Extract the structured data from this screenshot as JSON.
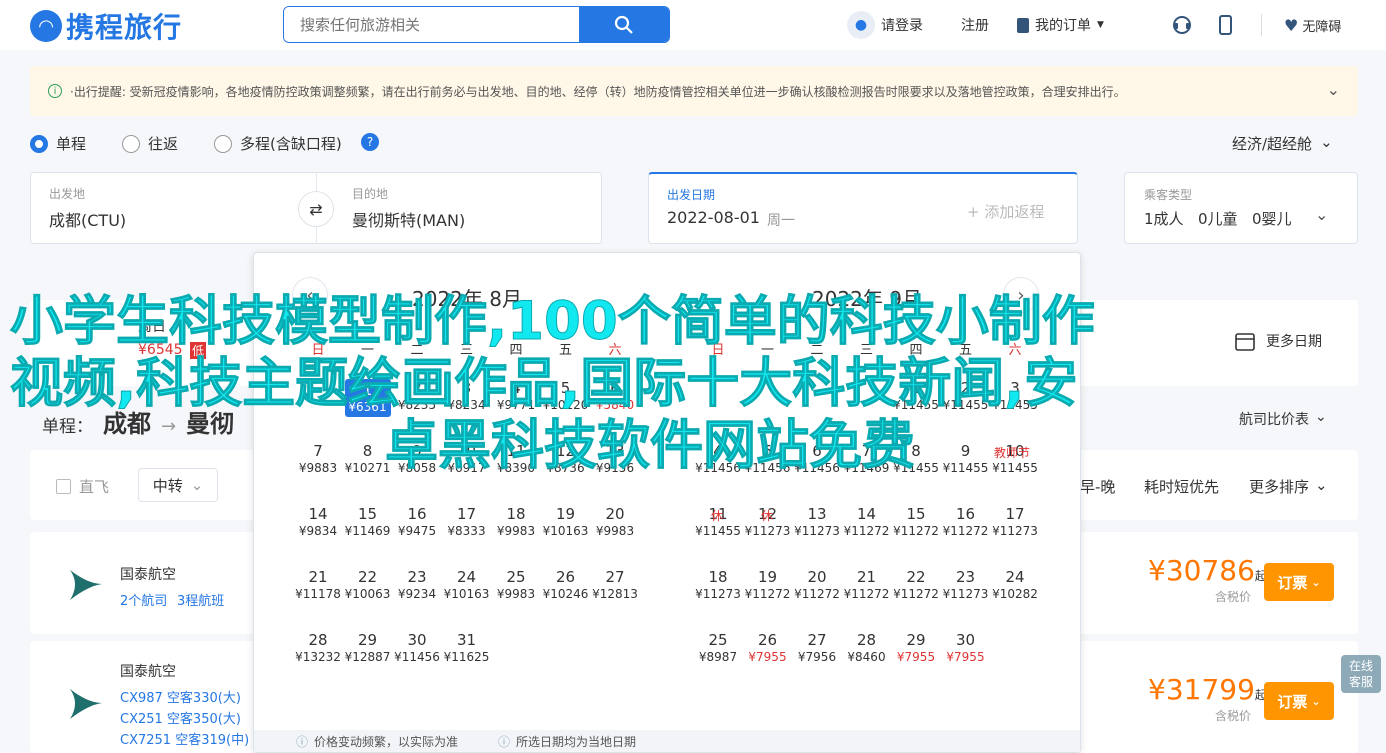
{
  "header": {
    "logo": "携程旅行",
    "search_placeholder": "搜索任何旅游相关",
    "login": "请登录",
    "register": "注册",
    "my_orders": "我的订单",
    "accessible": "无障碍"
  },
  "notice": {
    "text": "·出行提醒: 受新冠疫情影响，各地疫情防控政策调整频繁，请在出行前务必与出发地、目的地、经停（转）地防疫情管控相关单位进一步确认核酸检测报告时限要求以及落地管控政策，合理安排出行。"
  },
  "trip_types": {
    "one_way": "单程",
    "round_trip": "往返",
    "multi": "多程(含缺口程)",
    "cabin_class": "经济/超经舱"
  },
  "search_form": {
    "from_label": "出发地",
    "from_value": "成都(CTU)",
    "to_label": "目的地",
    "to_value": "曼彻斯特(MAN)",
    "date_label": "出发日期",
    "date_value": "2022-08-01",
    "date_weekday": "周一",
    "add_return": "+ 添加返程",
    "passenger_label": "乘客类型",
    "adult": "1成人",
    "child": "0儿童",
    "infant": "0婴儿"
  },
  "calendar": {
    "left_title": "2022年 8月",
    "right_title": "2022年 9月",
    "weekdays": [
      "日",
      "一",
      "二",
      "三",
      "四",
      "五",
      "六"
    ],
    "august": [
      {
        "d": "1",
        "p": "¥6361",
        "sel": true
      },
      {
        "d": "2",
        "p": "¥8235"
      },
      {
        "d": "3",
        "p": "¥8234"
      },
      {
        "d": "4",
        "p": "¥9771"
      },
      {
        "d": "5",
        "p": "¥10120"
      },
      {
        "d": "6",
        "p": "¥5840",
        "red": true
      },
      {
        "d": "7",
        "p": "¥9883"
      },
      {
        "d": "8",
        "p": "¥10271"
      },
      {
        "d": "9",
        "p": "¥8058"
      },
      {
        "d": "10",
        "p": "¥6917"
      },
      {
        "d": "11",
        "p": "¥8390"
      },
      {
        "d": "12",
        "p": "¥8736"
      },
      {
        "d": "13",
        "p": "¥9156"
      },
      {
        "d": "14",
        "p": "¥9834"
      },
      {
        "d": "15",
        "p": "¥11469"
      },
      {
        "d": "16",
        "p": "¥9475"
      },
      {
        "d": "17",
        "p": "¥8333"
      },
      {
        "d": "18",
        "p": "¥9983"
      },
      {
        "d": "19",
        "p": "¥10163"
      },
      {
        "d": "20",
        "p": "¥9983"
      },
      {
        "d": "21",
        "p": "¥11178"
      },
      {
        "d": "22",
        "p": "¥10063"
      },
      {
        "d": "23",
        "p": "¥9234"
      },
      {
        "d": "24",
        "p": "¥10163"
      },
      {
        "d": "25",
        "p": "¥9983"
      },
      {
        "d": "26",
        "p": "¥10246"
      },
      {
        "d": "27",
        "p": "¥12813"
      },
      {
        "d": "28",
        "p": "¥13232"
      },
      {
        "d": "29",
        "p": "¥12887"
      },
      {
        "d": "30",
        "p": "¥11456"
      },
      {
        "d": "31",
        "p": "¥11625"
      }
    ],
    "september": [
      {
        "d": "1",
        "p": "¥11455"
      },
      {
        "d": "2",
        "p": "¥11455"
      },
      {
        "d": "3",
        "p": "¥11455"
      },
      {
        "d": "4",
        "p": "¥11456"
      },
      {
        "d": "5",
        "p": "¥11456"
      },
      {
        "d": "6",
        "p": "¥11456"
      },
      {
        "d": "7",
        "p": "¥11469"
      },
      {
        "d": "8",
        "p": "¥11455"
      },
      {
        "d": "9",
        "p": "¥11455"
      },
      {
        "d": "10",
        "p": "¥11455"
      },
      {
        "d": "11",
        "p": "¥11455"
      },
      {
        "d": "12",
        "p": "¥11273"
      },
      {
        "d": "13",
        "p": "¥11273"
      },
      {
        "d": "14",
        "p": "¥11272"
      },
      {
        "d": "15",
        "p": "¥11272"
      },
      {
        "d": "16",
        "p": "¥11272"
      },
      {
        "d": "17",
        "p": "¥11273"
      },
      {
        "d": "18",
        "p": "¥11273"
      },
      {
        "d": "19",
        "p": "¥11272"
      },
      {
        "d": "20",
        "p": "¥11272"
      },
      {
        "d": "21",
        "p": "¥11272"
      },
      {
        "d": "22",
        "p": "¥11272"
      },
      {
        "d": "23",
        "p": "¥11273"
      },
      {
        "d": "24",
        "p": "¥10282"
      },
      {
        "d": "25",
        "p": "¥8987"
      },
      {
        "d": "26",
        "p": "¥7955",
        "red": true
      },
      {
        "d": "27",
        "p": "¥7956"
      },
      {
        "d": "28",
        "p": "¥8460"
      },
      {
        "d": "29",
        "p": "¥7955",
        "red": true
      },
      {
        "d": "30",
        "p": "¥7955",
        "red": true
      }
    ],
    "tag_teacher": "教师节",
    "tag_rest": "休",
    "foot_note1": "价格变动频繁，以实际为准",
    "foot_note2": "所选日期均为当地日期"
  },
  "overlay_text": {
    "line1": "小学生科技模型制作,100个简单的科技小制作",
    "line2": "视频,科技主题绘画作品,国际十大科技新闻,安",
    "line3": "卓黑科技软件网站免费"
  },
  "behind": {
    "week_tab_date": "周日",
    "week_tab_price": "¥6545",
    "week_tab_low": "低",
    "route_prefix": "单程：",
    "route_from": "成都",
    "route_to": "曼彻",
    "more_dates": "更多日期",
    "compare": "航司比价表",
    "direct": "直飞",
    "transfer": "中转",
    "early_late": "早-晚",
    "shortest": "耗时短优先",
    "more_sort": "更多排序"
  },
  "flights": [
    {
      "airline": "国泰航空",
      "links": [
        "2个航司",
        "3程航班"
      ],
      "price": "¥30786",
      "qi": "起",
      "tax": "含税价",
      "book": "订票"
    },
    {
      "airline": "国泰航空",
      "segments": [
        "CX987 空客330(大)",
        "CX251 空客350(大)",
        "CX7251 空客319(中)"
      ],
      "price": "¥31799",
      "qi": "起",
      "tax": "含税价",
      "book": "订票"
    }
  ],
  "online_service": "在线客服"
}
